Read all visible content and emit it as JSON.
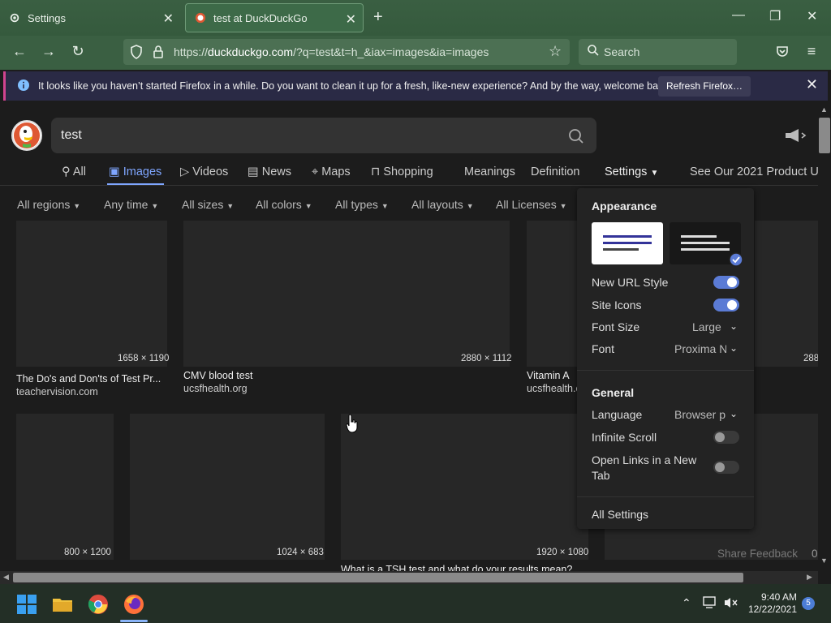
{
  "browser": {
    "tabs": [
      {
        "label": "Settings",
        "active": false,
        "icon": "gear-icon"
      },
      {
        "label": "test at DuckDuckGo",
        "active": true,
        "icon": "duckduckgo-favicon"
      }
    ],
    "url_prefix": "https://",
    "url_domain": "duckduckgo.com",
    "url_rest": "/?q=test&t=h_&iax=images&ia=images",
    "search_placeholder": "Search"
  },
  "notification": {
    "message": "It looks like you haven’t started Firefox in a while. Do you want to clean it up for a fresh, like-new experience? And by the way, welcome back!",
    "button": "Refresh Firefox…"
  },
  "ddg": {
    "query": "test",
    "tabs": {
      "all": "All",
      "images": "Images",
      "videos": "Videos",
      "news": "News",
      "maps": "Maps",
      "shopping": "Shopping",
      "meanings": "Meanings",
      "definition": "Definition",
      "settings": "Settings",
      "promo": "See Our 2021 Product Up"
    },
    "filters": {
      "regions": "All regions",
      "time": "Any time",
      "sizes": "All sizes",
      "colors": "All colors",
      "types": "All types",
      "layouts": "All layouts",
      "licenses": "All Licenses"
    },
    "results_row1": [
      {
        "dims": "1658 × 1190",
        "title": "The Do's and Don'ts of Test Pr...",
        "source": "teachervision.com"
      },
      {
        "dims": "2880 × 1112",
        "title": "CMV blood test",
        "source": "ucsfhealth.org"
      },
      {
        "dims": "",
        "title": "Vitamin A",
        "source": "ucsfhealth.o"
      },
      {
        "dims": "288",
        "title": "",
        "source": ""
      }
    ],
    "results_row2": [
      {
        "dims": "800 × 1200",
        "title": ""
      },
      {
        "dims": "1024 × 683",
        "title": ""
      },
      {
        "dims": "1920 × 1080",
        "title": "What is a TSH test and what do your results mean?"
      }
    ],
    "share_feedback": "Share Feedback",
    "share_feedback_tail": "0"
  },
  "settings_dropdown": {
    "appearance_heading": "Appearance",
    "new_url_style": {
      "label": "New URL Style",
      "on": true
    },
    "site_icons": {
      "label": "Site Icons",
      "on": true
    },
    "font_size": {
      "label": "Font Size",
      "value": "Large"
    },
    "font": {
      "label": "Font",
      "value": "Proxima N"
    },
    "general_heading": "General",
    "language": {
      "label": "Language",
      "value": "Browser p"
    },
    "infinite_scroll": {
      "label": "Infinite Scroll",
      "on": false
    },
    "open_links": {
      "label": "Open Links in a New Tab",
      "on": false
    },
    "all_settings": "All Settings"
  },
  "taskbar": {
    "time": "9:40 AM",
    "date": "12/22/2021",
    "notification_count": "5"
  },
  "colors": {
    "accent": "#7fa6ff",
    "chrome": "#3a5f42",
    "toggle_on": "#5b7bd5"
  }
}
